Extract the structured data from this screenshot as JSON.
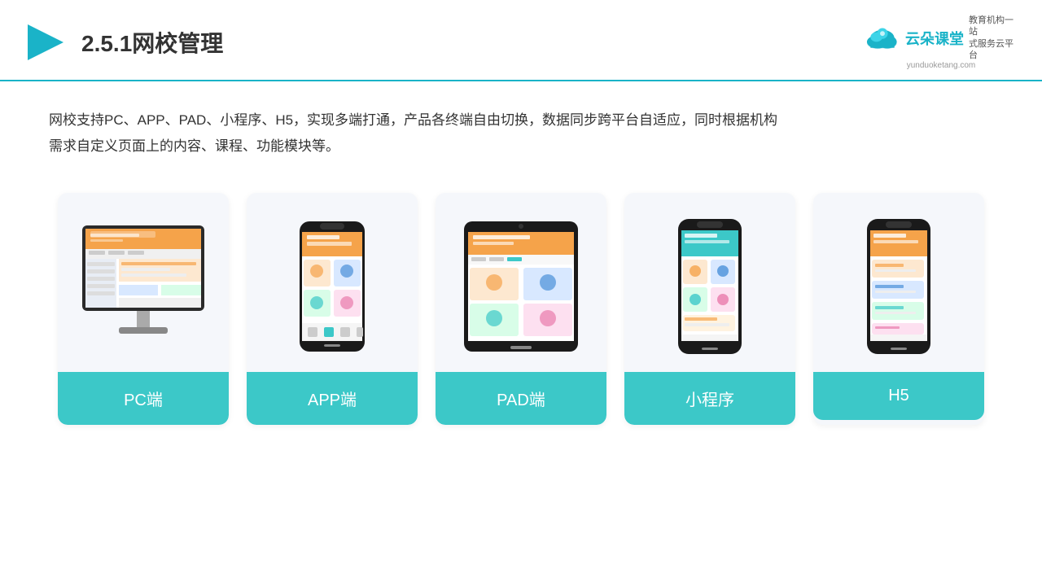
{
  "header": {
    "title": "2.5.1网校管理",
    "logo_name": "云朵课堂",
    "logo_url": "yunduoketang.com",
    "logo_tagline": "教育机构一站\n式服务云平台"
  },
  "description": {
    "text": "网校支持PC、APP、PAD、小程序、H5，实现多端打通，产品各终端自由切换，数据同步跨平台自适应，同时根据机构需求自定义页面上的内容、课程、功能模块等。"
  },
  "cards": [
    {
      "id": "pc",
      "label": "PC端",
      "device": "pc"
    },
    {
      "id": "app",
      "label": "APP端",
      "device": "phone"
    },
    {
      "id": "pad",
      "label": "PAD端",
      "device": "tablet"
    },
    {
      "id": "miniprogram",
      "label": "小程序",
      "device": "miniphone"
    },
    {
      "id": "h5",
      "label": "H5",
      "device": "h5phone"
    }
  ],
  "accent_color": "#3cc8c8"
}
